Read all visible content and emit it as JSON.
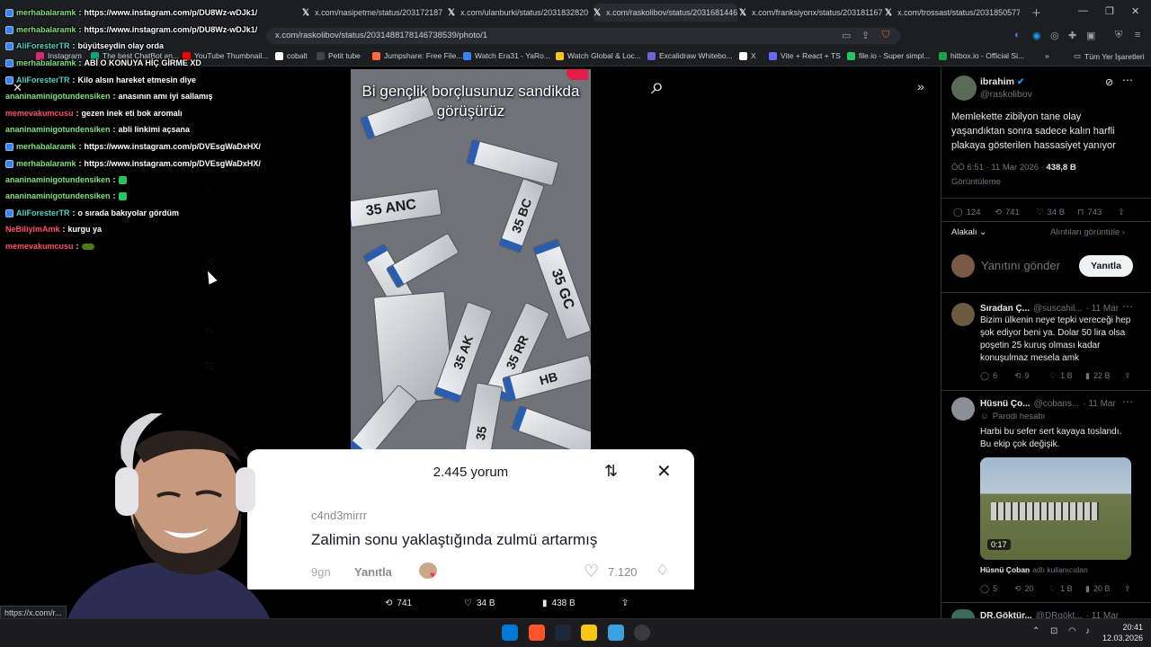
{
  "browser": {
    "tabs": [
      {
        "label": "x.com/nasipetme/status/203172187"
      },
      {
        "label": "x.com/ulanburki/status/2031832820"
      },
      {
        "label": "x.com/raskolibov/status/2031681446"
      },
      {
        "label": "x.com/franksiyonx/status/203181167"
      },
      {
        "label": "x.com/trossast/status/2031850577"
      }
    ],
    "url": "x.com/raskolibov/status/2031488178146738539/photo/1",
    "bookmarks": [
      {
        "label": "Instagram",
        "color": "#d62976"
      },
      {
        "label": "The best ChatBot an...",
        "color": "#10a37f"
      },
      {
        "label": "YouTube Thumbnail...",
        "color": "#ff0000"
      },
      {
        "label": "cobalt",
        "color": "#ffffff"
      },
      {
        "label": "Petit tube",
        "color": "#222222"
      },
      {
        "label": "Jumpshare: Free File...",
        "color": "#ff6b35"
      },
      {
        "label": "Watch Era31 - YaRo...",
        "color": "#3b82f6"
      },
      {
        "label": "Watch Global & Loc...",
        "color": "#f5c518"
      },
      {
        "label": "Excalidraw Whitebo...",
        "color": "#6965db"
      },
      {
        "label": "X",
        "color": "#ffffff"
      },
      {
        "label": "Vite + React + TS",
        "color": "#646cff"
      },
      {
        "label": "file.io - Super simpl...",
        "color": "#22c55e"
      },
      {
        "label": "hitbox.io - Official Si...",
        "color": "#16a34a"
      }
    ],
    "all_bookmarks": "Tüm Yer İşaretleri",
    "status_link": "https://x.com/r..."
  },
  "photo": {
    "caption": "Bi gençlik borçlusunuz sandikda görüşürüz"
  },
  "comments_sheet": {
    "count": "2.445 yorum",
    "username": "c4nd3mirrr",
    "text": "Zalimin sonu yaklaştığında zulmü artarmış",
    "time_partial": "9gn",
    "reply": "Yanıtla",
    "likes": "7.120"
  },
  "action_bar": {
    "reposts": "741",
    "likes": "34 B",
    "views": "438 B"
  },
  "tweet": {
    "author": "ibrahim",
    "handle": "@raskolibov",
    "text": "Memlekette zibilyon tane olay yaşandıktan sonra sadece kalın harfli plakaya gösterilen hassasiyet yanıyor",
    "timestamp": "ÖÖ 6:51 · 11 Mar 2026 · ",
    "views_count": "438,8 B",
    "views_label": "Görüntüleme",
    "replies": "124",
    "reposts": "741",
    "likes": "34 B",
    "bookmarks": "743",
    "sort": "Alakalı",
    "quotes_link": "Alıntıları görüntüle",
    "reply_placeholder": "Yanıtını gönder",
    "reply_button": "Yanıtla"
  },
  "replies": [
    {
      "name": "Sıradan Ç...",
      "handle": "@suscahil...",
      "date": "· 11 Mar",
      "text": "Bizim ülkenin neye tepki vereceği hep şok ediyor beni ya. Dolar 50 lira olsa poşetin 25 kuruş olması kadar konuşulmaz mesela amk",
      "replies": "6",
      "reposts": "9",
      "likes": "1 B",
      "views": "22 B"
    },
    {
      "name": "Hüsnü Ço...",
      "handle": "@cobans...",
      "date": "· 11 Mar",
      "parody": "Parodi hesabı",
      "text": "Harbi bu sefer sert kayaya toslandı. Bu ekip çok değişik.",
      "video_duration": "0:17",
      "video_credit_name": "Hüsnü Çoban",
      "video_credit_suffix": "adlı kullanıcıdan",
      "replies": "5",
      "reposts": "20",
      "likes": "1 B",
      "views": "20 B"
    },
    {
      "name": "DR.Göktür...",
      "handle": "@DRgökt...",
      "date": "· 11 Mar"
    }
  ],
  "chat": [
    {
      "user": "merhabalaramk",
      "color": "#7fe07f",
      "msg": "https://www.instagram.com/p/DU8Wz-wDJk1/",
      "badge": true
    },
    {
      "user": "merhabalaramk",
      "color": "#7fe07f",
      "msg": "https://www.instagram.com/p/DU8Wz-wDJk1/",
      "badge": true
    },
    {
      "user": "AliForesterTR",
      "color": "#4fd1c5",
      "msg": "büyütseydin olay orda",
      "badge": true
    },
    {
      "user": "merhabalaramk",
      "color": "#7fe07f",
      "msg": "ABİ O KONUYA HİÇ GİRME XD",
      "badge": true
    },
    {
      "user": "AliForesterTR",
      "color": "#4fd1c5",
      "msg": "Kilo alsın hareket etmesin diye",
      "badge": true
    },
    {
      "user": "ananinaminigotundensiken",
      "color": "#7fe07f",
      "msg": "anasının amı iyi sallamış",
      "badge": false
    },
    {
      "user": "memevakumcusu",
      "color": "#ff4d6d",
      "msg": "gezen inek eti bok aromalı",
      "badge": false
    },
    {
      "user": "ananinaminigotundensiken",
      "color": "#7fe07f",
      "msg": "abli linkimi açsana",
      "badge": false
    },
    {
      "user": "merhabalaramk",
      "color": "#7fe07f",
      "msg": "https://www.instagram.com/p/DVEsgWaDxHX/",
      "badge": true
    },
    {
      "user": "merhabalaramk",
      "color": "#7fe07f",
      "msg": "https://www.instagram.com/p/DVEsgWaDxHX/",
      "badge": true
    },
    {
      "user": "ananinaminigotundensiken",
      "color": "#7fe07f",
      "msg": "",
      "badge": false
    },
    {
      "user": "ananinaminigotundensiken",
      "color": "#7fe07f",
      "msg": "",
      "badge": false
    },
    {
      "user": "AliForesterTR",
      "color": "#4fd1c5",
      "msg": "o sırada bakıyolar gördüm",
      "badge": true
    },
    {
      "user": "NeBiliyimAmk",
      "color": "#ff4d6d",
      "msg": "kurgu ya",
      "badge": false
    },
    {
      "user": "memevakumcusu",
      "color": "#ff4d6d",
      "msg": "",
      "badge": false
    }
  ],
  "taskbar": {
    "time": "20:41",
    "date": "12.03.2026"
  },
  "colors": {
    "x_bg": "#000000",
    "accent_blue": "#1d9bf0",
    "muted": "#71767b",
    "sheet_bg": "#ffffff"
  }
}
